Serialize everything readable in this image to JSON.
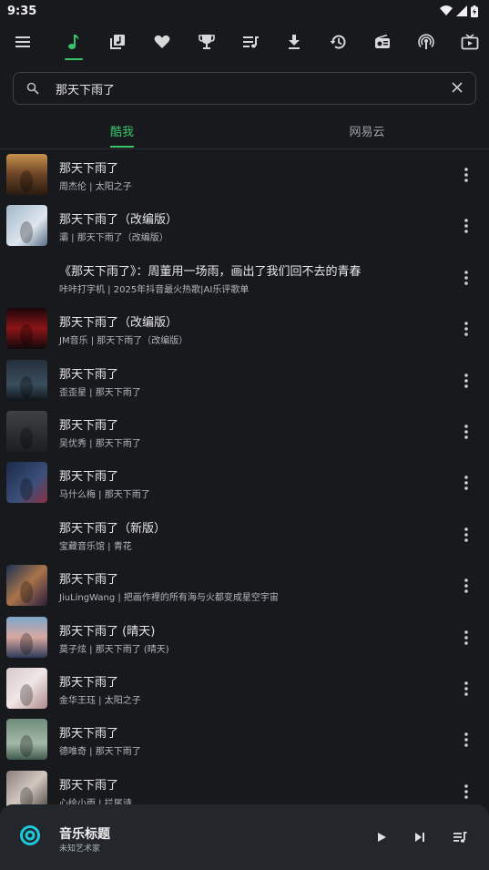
{
  "status_bar": {
    "time": "9:35"
  },
  "nav": {
    "items": [
      {
        "icon": "menu-icon"
      },
      {
        "icon": "music-note-icon",
        "active": true
      },
      {
        "icon": "library-icon"
      },
      {
        "icon": "heart-icon"
      },
      {
        "icon": "trophy-icon"
      },
      {
        "icon": "playlist-icon"
      },
      {
        "icon": "download-icon"
      },
      {
        "icon": "history-icon"
      },
      {
        "icon": "radio-icon"
      },
      {
        "icon": "podcast-icon"
      },
      {
        "icon": "tv-icon"
      }
    ]
  },
  "search": {
    "value": "那天下雨了"
  },
  "source_tabs": [
    {
      "label": "酷我",
      "active": true
    },
    {
      "label": "网易云",
      "active": false
    }
  ],
  "songs": [
    {
      "title": "那天下雨了",
      "subtitle": "周杰伦 | 太阳之子",
      "cover": "warm"
    },
    {
      "title": "那天下雨了（改编版）",
      "subtitle": "灞 | 那天下雨了（改编版）",
      "cover": "anime"
    },
    {
      "title": "《那天下雨了》：周董用一场雨，画出了我们回不去的青春",
      "subtitle": "咔咔打字机 | 2025年抖音最火热歌|AI乐评歌单",
      "cover": "none"
    },
    {
      "title": "那天下雨了（改编版）",
      "subtitle": "JM音乐 | 那天下雨了（改编版）",
      "cover": "red"
    },
    {
      "title": "那天下雨了",
      "subtitle": "歪歪星 | 那天下雨了",
      "cover": "rain-dark"
    },
    {
      "title": "那天下雨了",
      "subtitle": "吴优秀 | 那天下雨了",
      "cover": "grey"
    },
    {
      "title": "那天下雨了",
      "subtitle": "马什么梅 | 那天下雨了",
      "cover": "blue-red"
    },
    {
      "title": "那天下雨了（新版）",
      "subtitle": "宝藏音乐馆 | 青花",
      "cover": "none"
    },
    {
      "title": "那天下雨了",
      "subtitle": "JiuLingWang | 把画作裡的所有海与火都变成星空宇宙",
      "cover": "portrait"
    },
    {
      "title": "那天下雨了 (晴天)",
      "subtitle": "莫子炫 | 那天下雨了 (晴天)",
      "cover": "street"
    },
    {
      "title": "那天下雨了",
      "subtitle": "金华王珏 | 太阳之子",
      "cover": "pink"
    },
    {
      "title": "那天下雨了",
      "subtitle": "德唯奇 | 那天下雨了",
      "cover": "green"
    },
    {
      "title": "那天下雨了",
      "subtitle": "心绘小雨 | 拦尾诗",
      "cover": "girl"
    }
  ],
  "player": {
    "title": "音乐标题",
    "artist": "未知艺术家"
  },
  "colors": {
    "accent": "#3ac46a",
    "background": "#17191d",
    "player": "#23262b"
  }
}
